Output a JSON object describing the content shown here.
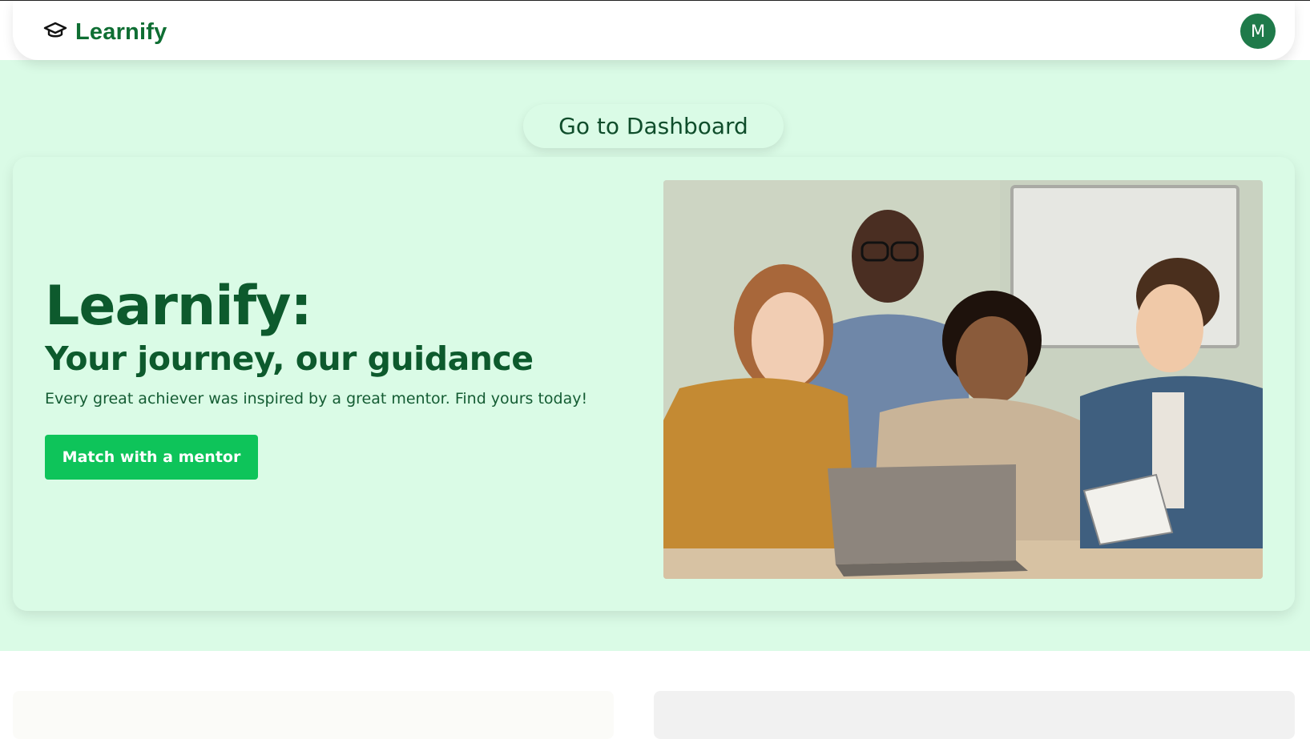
{
  "header": {
    "brand_name": "Learnify",
    "brand_icon": "graduation-cap-icon",
    "avatar_initial": "M"
  },
  "hero": {
    "dashboard_button": "Go to Dashboard",
    "title": "Learnify:",
    "subtitle": "Your journey, our guidance",
    "description": "Every great achiever was inspired by a great mentor. Find yours today!",
    "cta_button": "Match with a mentor",
    "image_icon": "students-with-mentor-photo"
  },
  "colors": {
    "brand_green": "#0f6e33",
    "hero_background": "#dafbe6",
    "cta_green": "#0ec45a",
    "avatar_green": "#1f7a4a"
  }
}
